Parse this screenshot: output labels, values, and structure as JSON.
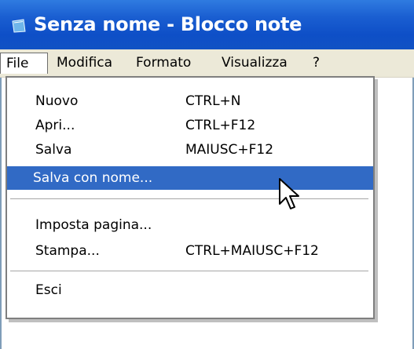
{
  "window": {
    "title": "Senza nome - Blocco note",
    "icon": "notepad-icon"
  },
  "menubar": {
    "items": [
      {
        "label": "File",
        "active": true
      },
      {
        "label": "Modifica"
      },
      {
        "label": "Formato"
      },
      {
        "label": "Visualizza"
      },
      {
        "label": "?"
      }
    ]
  },
  "file_menu": {
    "items": [
      {
        "label": "Nuovo",
        "shortcut": "CTRL+N"
      },
      {
        "label": "Apri...",
        "shortcut": "CTRL+F12"
      },
      {
        "label": "Salva",
        "shortcut": "MAIUSC+F12"
      },
      {
        "label": "Salva con nome...",
        "shortcut": "",
        "highlighted": true
      },
      {
        "label": "Imposta pagina...",
        "shortcut": ""
      },
      {
        "label": "Stampa...",
        "shortcut": "CTRL+MAIUSC+F12"
      },
      {
        "label": "Esci",
        "shortcut": ""
      }
    ]
  },
  "colors": {
    "titlebar": "#0e4fc7",
    "menubar": "#ece9d8",
    "highlight": "#316ac5"
  },
  "cursor": "mouse-pointer-icon"
}
